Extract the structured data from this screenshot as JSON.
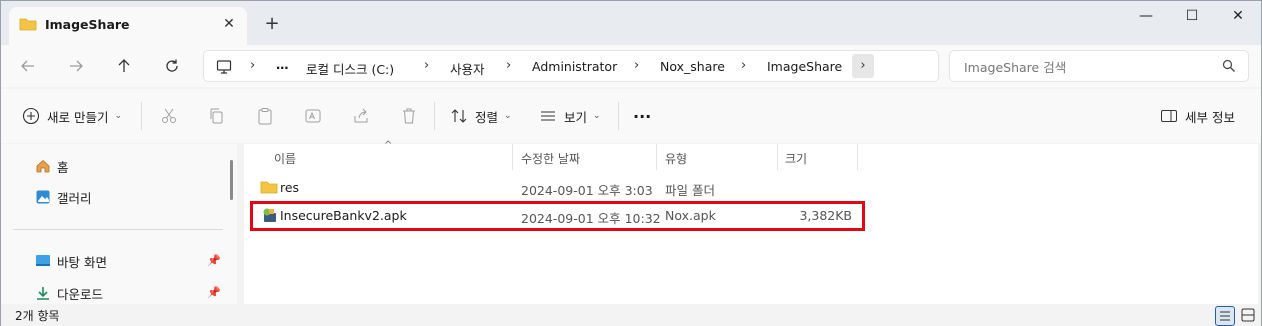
{
  "window": {
    "tab_title": "ImageShare",
    "new_tab_label": "+",
    "minimize_label": "—",
    "maximize_label": "☐",
    "close_label": "✕"
  },
  "nav": {
    "back_icon": "arrow-left-icon",
    "forward_icon": "arrow-right-icon",
    "up_icon": "arrow-up-icon",
    "refresh_icon": "refresh-icon"
  },
  "address": {
    "crumbs": [
      "…",
      "로컬 디스크 (C:)",
      "사용자",
      "Administrator",
      "Nox_share",
      "ImageShare"
    ],
    "separator": "›"
  },
  "search": {
    "placeholder": "ImageShare 검색"
  },
  "toolbar": {
    "new_label": "새로 만들기",
    "sort_label": "정렬",
    "view_label": "보기",
    "more_label": "···",
    "details_label": "세부 정보"
  },
  "sidebar": {
    "items": [
      {
        "label": "홈",
        "icon": "home-icon"
      },
      {
        "label": "갤러리",
        "icon": "gallery-icon"
      },
      {
        "label": "바탕 화면",
        "icon": "desktop-icon"
      },
      {
        "label": "다운로드",
        "icon": "download-icon"
      }
    ]
  },
  "files": {
    "columns": [
      "이름",
      "수정한 날짜",
      "유형",
      "크기"
    ],
    "rows": [
      {
        "name": "res",
        "date": "2024-09-01 오후 3:03",
        "type": "파일 폴더",
        "size": "",
        "icon": "folder-icon"
      },
      {
        "name": "InsecureBankv2.apk",
        "date": "2024-09-01 오후 10:32",
        "type": "Nox.apk",
        "size": "3,382KB",
        "icon": "apk-icon"
      }
    ],
    "highlight_color": "#e30613"
  },
  "status": {
    "item_count": "2개 항목"
  },
  "colors": {
    "folder": "#f4c542",
    "accent": "#2b5aa8"
  }
}
